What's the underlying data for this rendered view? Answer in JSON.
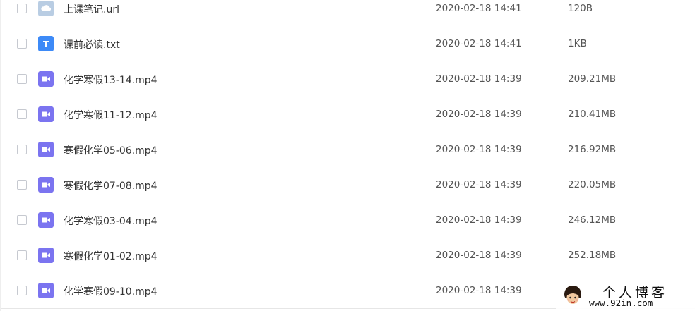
{
  "files": [
    {
      "name": "上课笔记.url",
      "date": "2020-02-18 14:41",
      "size": "120B",
      "icon": "cloud-file-icon"
    },
    {
      "name": "课前必读.txt",
      "date": "2020-02-18 14:41",
      "size": "1KB",
      "icon": "text-file-icon"
    },
    {
      "name": "化学寒假13-14.mp4",
      "date": "2020-02-18 14:39",
      "size": "209.21MB",
      "icon": "video-file-icon"
    },
    {
      "name": "化学寒假11-12.mp4",
      "date": "2020-02-18 14:39",
      "size": "210.41MB",
      "icon": "video-file-icon"
    },
    {
      "name": "寒假化学05-06.mp4",
      "date": "2020-02-18 14:39",
      "size": "216.92MB",
      "icon": "video-file-icon"
    },
    {
      "name": "寒假化学07-08.mp4",
      "date": "2020-02-18 14:39",
      "size": "220.05MB",
      "icon": "video-file-icon"
    },
    {
      "name": "化学寒假03-04.mp4",
      "date": "2020-02-18 14:39",
      "size": "246.12MB",
      "icon": "video-file-icon"
    },
    {
      "name": "寒假化学01-02.mp4",
      "date": "2020-02-18 14:39",
      "size": "252.18MB",
      "icon": "video-file-icon"
    },
    {
      "name": "化学寒假09-10.mp4",
      "date": "2020-02-18 14:39",
      "size": "",
      "icon": "video-file-icon"
    }
  ],
  "watermark": {
    "title": "个人博客",
    "url": "www.92in.com"
  },
  "colors": {
    "url_icon": "#b9cde3",
    "txt_icon": "#3d8af7",
    "video_icon": "#7b74f0",
    "text": "#333333",
    "meta": "#555555"
  }
}
